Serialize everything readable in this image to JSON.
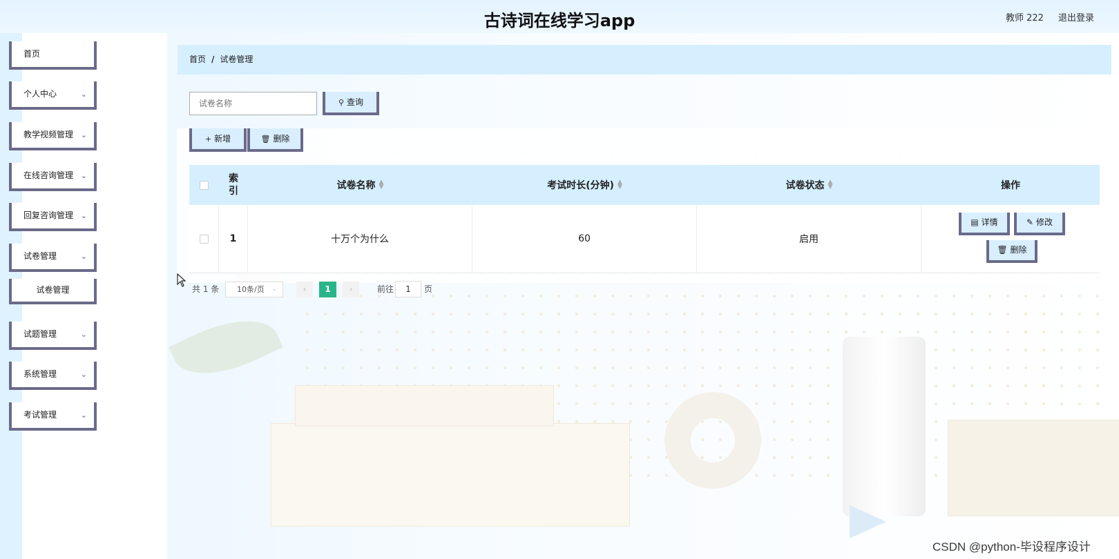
{
  "header": {
    "app_title": "古诗词在线学习app",
    "user_name": "教师 222",
    "logout_label": "退出登录"
  },
  "sidebar": {
    "items": [
      {
        "label": "首页",
        "has_children": false
      },
      {
        "label": "个人中心",
        "has_children": true
      },
      {
        "label": "教学视频管理",
        "has_children": true
      },
      {
        "label": "在线咨询管理",
        "has_children": true
      },
      {
        "label": "回复咨询管理",
        "has_children": true
      },
      {
        "label": "试卷管理",
        "has_children": true,
        "expanded": true
      },
      {
        "label": "试题管理",
        "has_children": true
      },
      {
        "label": "系统管理",
        "has_children": true
      },
      {
        "label": "考试管理",
        "has_children": true
      }
    ],
    "subitems": [
      {
        "label": "试卷管理"
      }
    ],
    "chevron": "chevron-down-icon"
  },
  "breadcrumb": {
    "home": "首页",
    "separator": "/",
    "current": "试卷管理"
  },
  "search": {
    "placeholder": "试卷名称",
    "query_button": "查询"
  },
  "toolbar": {
    "add_label": "新增",
    "delete_label": "删除"
  },
  "table": {
    "columns": [
      {
        "label": "索引"
      },
      {
        "label": "试卷名称",
        "sortable": true
      },
      {
        "label": "考试时长(分钟)",
        "sortable": true
      },
      {
        "label": "试卷状态",
        "sortable": true
      },
      {
        "label": "操作"
      }
    ],
    "index_head_top": "索",
    "index_head_bottom": "引",
    "rows": [
      {
        "index": "1",
        "name": "十万个为什么",
        "duration": "60",
        "status": "启用"
      }
    ],
    "actions": {
      "detail": "详情",
      "edit": "修改",
      "delete": "删除"
    }
  },
  "pagination": {
    "total": "共 1 条",
    "page_size": "10条/页",
    "current_page": "1",
    "goto_label": "前往",
    "goto_value": "1",
    "page_suffix": "页"
  },
  "watermark": "CSDN @python-毕设程序设计",
  "colors": {
    "header_bg": "#e3f3ff",
    "breadcrumb_bg": "#d6efff",
    "button_bg": "#d9efff",
    "button_border": "#6a6a8a",
    "pager_active": "#2bb48a"
  }
}
